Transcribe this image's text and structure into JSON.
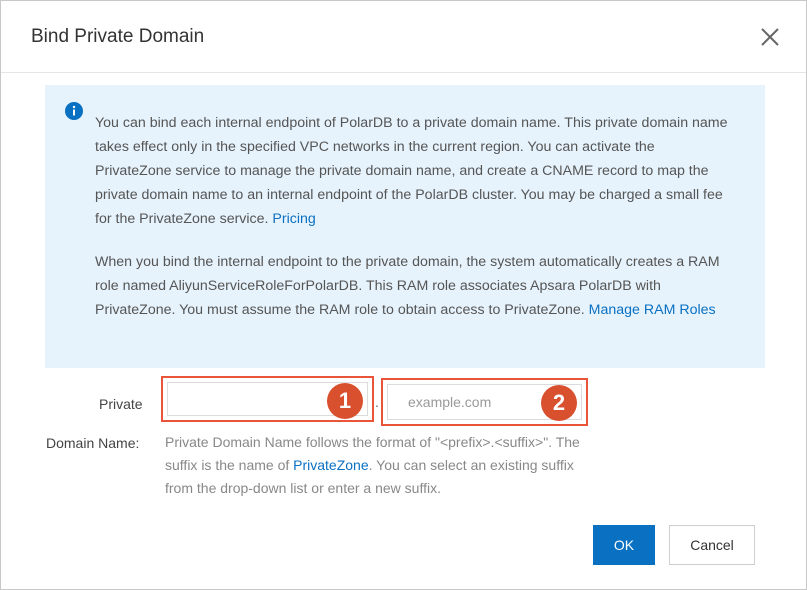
{
  "dialog": {
    "title": "Bind Private Domain",
    "close_icon": "close-icon"
  },
  "notice": {
    "icon": "info-icon",
    "icon_color": "#0a70c2",
    "background": "#e6f3fc",
    "paragraph1": "You can bind each internal endpoint of PolarDB to a private domain name. This private domain name takes effect only in the specified VPC networks in the current region. You can activate the PrivateZone service to manage the private domain name, and create a CNAME record to map the private domain name to an internal endpoint of the PolarDB cluster. You may be charged a small fee for the PrivateZone service. ",
    "paragraph1_link": "Pricing",
    "paragraph2": "When you bind the internal endpoint to the private domain, the system automatically creates a RAM role named AliyunServiceRoleForPolarDB. This RAM role associates Apsara PolarDB with PrivateZone. You must assume the RAM role to obtain access to PrivateZone. ",
    "paragraph2_link": "Manage RAM Roles"
  },
  "form": {
    "label_line1": "Private",
    "label_line2": "Domain Name:",
    "prefix_value": "",
    "prefix_placeholder": "",
    "separator": ".",
    "suffix_value": "",
    "suffix_placeholder": "example.com",
    "badge1": "1",
    "badge2": "2",
    "highlight_color": "#e8553a",
    "help_before": "Private Domain Name follows the format of \"<prefix>.<suffix>\". The suffix is the name of ",
    "help_link": "PrivateZone",
    "help_after": ". You can select an existing suffix from the drop-down list or enter a new suffix."
  },
  "footer": {
    "ok_label": "OK",
    "cancel_label": "Cancel",
    "primary_color": "#0a70c2"
  }
}
